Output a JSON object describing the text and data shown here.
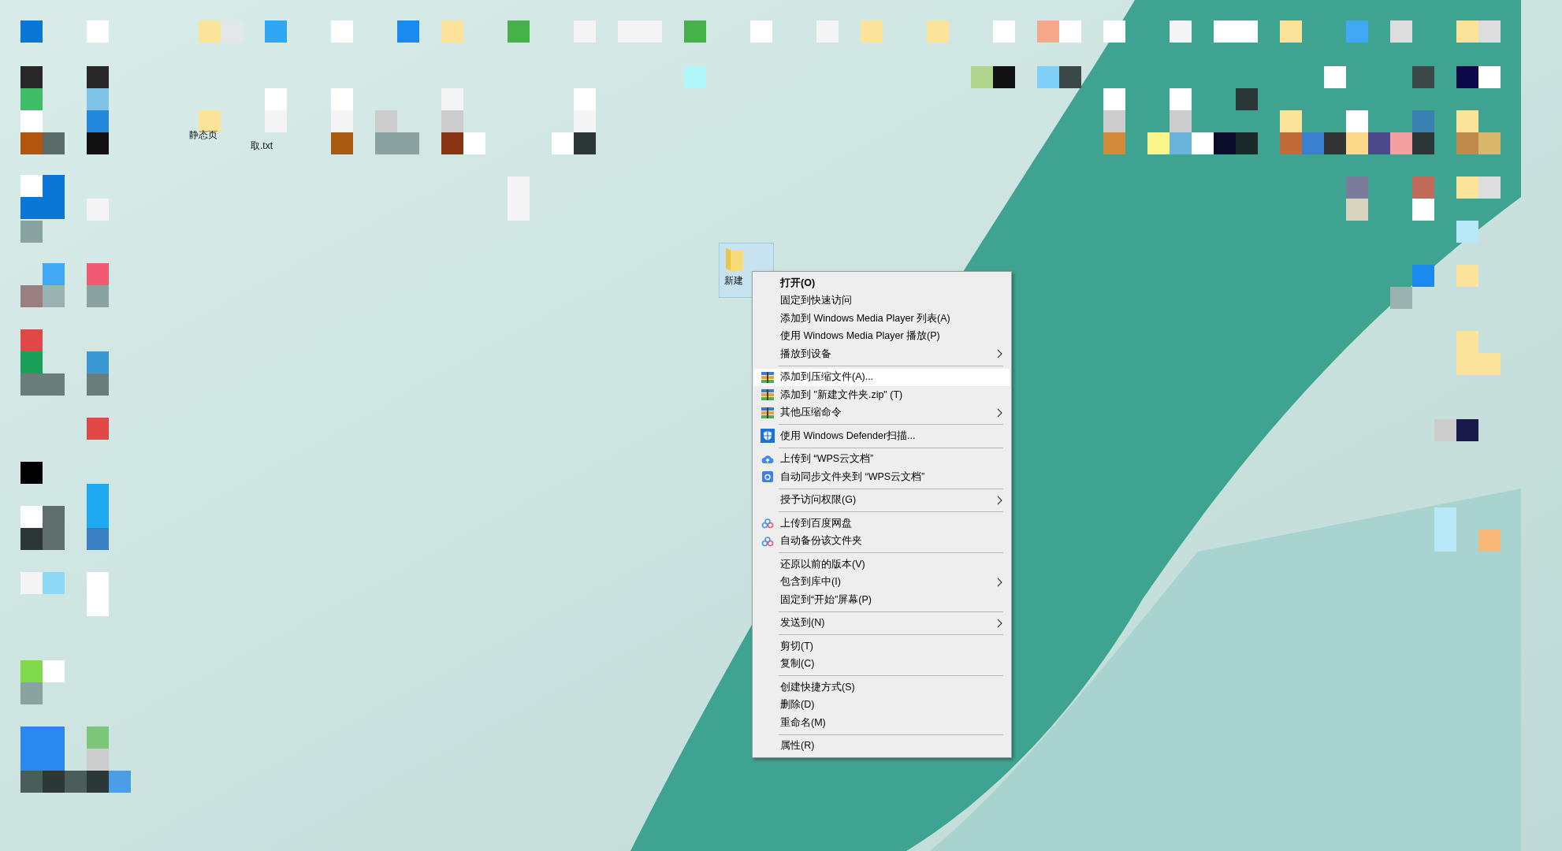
{
  "desktop_icons": [
    {
      "label": "静态页",
      "kind": "plain"
    },
    {
      "label": "取.txt",
      "kind": "plain"
    },
    {
      "label": "新建",
      "kind": "folder"
    }
  ],
  "context_menu": {
    "groups": [
      [
        {
          "label": "打开(O)",
          "kind": "plain",
          "submenu": false,
          "default": true,
          "selected": false
        },
        {
          "label": "固定到快速访问",
          "kind": "plain",
          "submenu": false,
          "default": false,
          "selected": false
        },
        {
          "label": "添加到 Windows Media Player 列表(A)",
          "kind": "plain",
          "submenu": false,
          "default": false,
          "selected": false
        },
        {
          "label": "使用 Windows Media Player 播放(P)",
          "kind": "plain",
          "submenu": false,
          "default": false,
          "selected": false
        },
        {
          "label": "播放到设备",
          "kind": "plain",
          "submenu": true,
          "default": false,
          "selected": false
        }
      ],
      [
        {
          "label": "添加到压缩文件(A)...",
          "kind": "archive",
          "submenu": false,
          "default": false,
          "selected": true
        },
        {
          "label": "添加到 \"新建文件夹.zip\" (T)",
          "kind": "archive",
          "submenu": false,
          "default": false,
          "selected": false
        },
        {
          "label": "其他压缩命令",
          "kind": "archive",
          "submenu": true,
          "default": false,
          "selected": false
        }
      ],
      [
        {
          "label": "使用 Windows Defender扫描...",
          "kind": "shield",
          "submenu": false,
          "default": false,
          "selected": false
        }
      ],
      [
        {
          "label": "上传到 “WPS云文档”",
          "kind": "cloud",
          "submenu": false,
          "default": false,
          "selected": false
        },
        {
          "label": "自动同步文件夹到 “WPS云文档”",
          "kind": "sync",
          "submenu": false,
          "default": false,
          "selected": false
        }
      ],
      [
        {
          "label": "授予访问权限(G)",
          "kind": "plain",
          "submenu": true,
          "default": false,
          "selected": false
        }
      ],
      [
        {
          "label": "上传到百度网盘",
          "kind": "rings",
          "submenu": false,
          "default": false,
          "selected": false
        },
        {
          "label": "自动备份该文件夹",
          "kind": "rings",
          "submenu": false,
          "default": false,
          "selected": false
        }
      ],
      [
        {
          "label": "还原以前的版本(V)",
          "kind": "plain",
          "submenu": false,
          "default": false,
          "selected": false
        },
        {
          "label": "包含到库中(I)",
          "kind": "plain",
          "submenu": true,
          "default": false,
          "selected": false
        },
        {
          "label": "固定到“开始”屏幕(P)",
          "kind": "plain",
          "submenu": false,
          "default": false,
          "selected": false
        }
      ],
      [
        {
          "label": "发送到(N)",
          "kind": "plain",
          "submenu": true,
          "default": false,
          "selected": false
        }
      ],
      [
        {
          "label": "剪切(T)",
          "kind": "plain",
          "submenu": false,
          "default": false,
          "selected": false
        },
        {
          "label": "复制(C)",
          "kind": "plain",
          "submenu": false,
          "default": false,
          "selected": false
        }
      ],
      [
        {
          "label": "创建快捷方式(S)",
          "kind": "plain",
          "submenu": false,
          "default": false,
          "selected": false
        },
        {
          "label": "删除(D)",
          "kind": "plain",
          "submenu": false,
          "default": false,
          "selected": false
        },
        {
          "label": "重命名(M)",
          "kind": "plain",
          "submenu": false,
          "default": false,
          "selected": false
        }
      ],
      [
        {
          "label": "属性(R)",
          "kind": "plain",
          "submenu": false,
          "default": false,
          "selected": false
        }
      ]
    ]
  }
}
